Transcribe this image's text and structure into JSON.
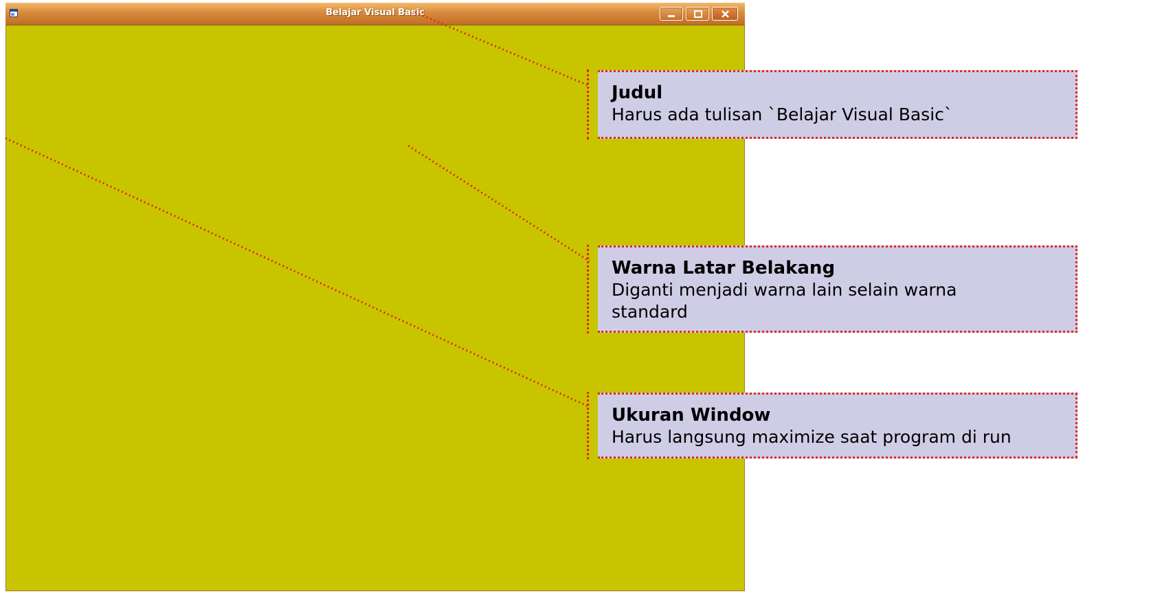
{
  "window": {
    "title": "Belajar Visual Basic",
    "background_color": "#c8c500",
    "icons": [
      "form-icon",
      "minimize-icon",
      "maximize-icon",
      "close-icon"
    ]
  },
  "callouts": [
    {
      "heading": "Judul",
      "text": "Harus ada tulisan `Belajar Visual Basic`"
    },
    {
      "heading": "Warna Latar Belakang",
      "text": "Diganti menjadi warna lain selain warna standard"
    },
    {
      "heading": "Ukuran Window",
      "text": "Harus langsung maximize saat program di run"
    }
  ],
  "colors": {
    "callout_bg": "#cfcde6",
    "dotted_line": "#e0281e"
  }
}
